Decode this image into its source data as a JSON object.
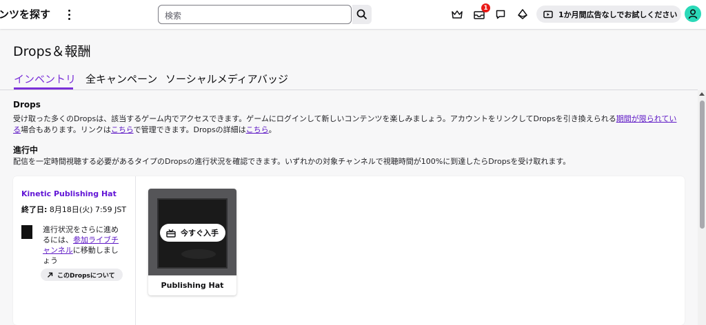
{
  "topnav": {
    "browse_label": "ンツを探す",
    "search_placeholder": "検索",
    "notification_count": "1",
    "prime_label": "1か月間広告なしでお試しください",
    "icons": [
      "more-vertical-icon",
      "search-icon",
      "crown-icon",
      "inbox-icon",
      "whispers-icon",
      "bits-icon",
      "prime-ad-icon",
      "user-avatar-icon"
    ]
  },
  "page": {
    "title": "Drops＆報酬",
    "tabs": [
      {
        "label": "インベントリ",
        "active": true
      },
      {
        "label": "全キャンペーン",
        "active": false
      },
      {
        "label": "ソーシャルメディアバッジ",
        "active": false
      }
    ]
  },
  "drops_section": {
    "heading": "Drops",
    "text_1": "受け取った多くのDropsは、該当するゲーム内でアクセスできます。ゲームにログインして新しいコンテンツを楽しみましょう。アカウントをリンクしてDropsを引き換えられる",
    "link_limited_1": "期間が限られてい",
    "link_limited_2": "る",
    "text_2": "場合もあります。リンクは",
    "link_here_1": "こちら",
    "text_3": "で管理できます。Dropsの詳細は",
    "link_here_2": "こちら",
    "text_4": "。"
  },
  "progress_section": {
    "heading": "進行中",
    "text": "配信を一定時間視聴する必要があるタイプのDropsの進行状況を確認できます。いずれかの対象チャンネルで視聴時間が100%に到達したらDropsを受け取れます。"
  },
  "campaign": {
    "title": "Kinetic Publishing Hat",
    "end_label": "終了日:",
    "end_value": "8月18日(火) 7:59 JST",
    "note_1": "進行状況をさらに進めるには、",
    "note_link": "参加ライブチャンネル",
    "note_2": "に移動しましょう",
    "about_label": "このDropsについて",
    "drop": {
      "name": "Publishing Hat",
      "claim_label": "今すぐ入手"
    }
  },
  "colors": {
    "accent": "#7a2fd8",
    "link": "#5c16c5",
    "badge": "#e91916",
    "avatar": "#2bd9b8"
  }
}
